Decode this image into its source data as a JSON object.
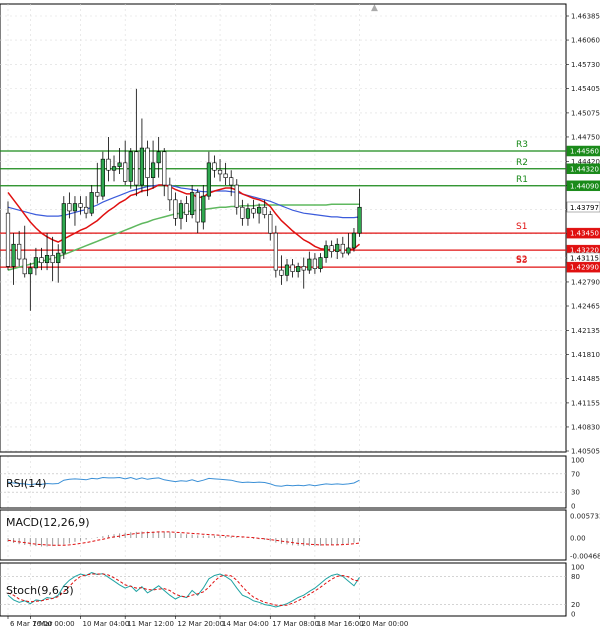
{
  "chart_data": {
    "type": "candlestick",
    "main": {
      "price_axis_ticks": [
        "1.46385",
        "1.46060",
        "1.45730",
        "1.45405",
        "1.45075",
        "1.44750",
        "1.44420",
        "1.44095",
        "1.43770",
        "1.43440",
        "1.43115",
        "1.42790",
        "1.42465",
        "1.42135",
        "1.41810",
        "1.41485",
        "1.41155",
        "1.40830",
        "1.40505"
      ],
      "ylim": [
        1.40505,
        1.46385
      ],
      "time_axis_ticks": [
        "6 Mar 16:00",
        "7 Mar 00:00",
        "10 Mar 04:00",
        "11 Mar 12:00",
        "12 Mar 20:00",
        "14 Mar 04:00",
        "17 Mar 08:00",
        "18 Mar 16:00",
        "20 Mar 00:00"
      ],
      "current_price": "1.43797",
      "levels": [
        {
          "label": "R3",
          "value": "1.44560",
          "color": "#1a8a1a"
        },
        {
          "label": "R2",
          "value": "1.44320",
          "color": "#1a8a1a"
        },
        {
          "label": "R1",
          "value": "1.44090",
          "color": "#1a8a1a"
        },
        {
          "label": "S1",
          "value": "1.43450",
          "color": "#e01010"
        },
        {
          "label": "",
          "value": "1.43220",
          "color": "#e01010"
        },
        {
          "label": "S2",
          "value": "",
          "color": "#e01010"
        },
        {
          "label": "",
          "value": "1.43115",
          "color": ""
        },
        {
          "label": "S3",
          "value": "1.42990",
          "color": "#e01010"
        }
      ],
      "candles": [
        [
          1.4372,
          1.4388,
          1.4295,
          1.43
        ],
        [
          1.43,
          1.4345,
          1.4275,
          1.433
        ],
        [
          1.433,
          1.4348,
          1.43,
          1.431
        ],
        [
          1.431,
          1.4355,
          1.4285,
          1.429
        ],
        [
          1.429,
          1.4305,
          1.424,
          1.4298
        ],
        [
          1.4298,
          1.4325,
          1.4288,
          1.4312
        ],
        [
          1.4312,
          1.4325,
          1.4295,
          1.4305
        ],
        [
          1.4305,
          1.4345,
          1.4295,
          1.4315
        ],
        [
          1.4315,
          1.434,
          1.428,
          1.4305
        ],
        [
          1.4305,
          1.433,
          1.4278,
          1.4318
        ],
        [
          1.4318,
          1.4395,
          1.431,
          1.4385
        ],
        [
          1.4385,
          1.44,
          1.4365,
          1.4375
        ],
        [
          1.4375,
          1.4395,
          1.4355,
          1.4385
        ],
        [
          1.4385,
          1.4395,
          1.437,
          1.438
        ],
        [
          1.438,
          1.4395,
          1.4365,
          1.4372
        ],
        [
          1.4372,
          1.441,
          1.4368,
          1.44
        ],
        [
          1.44,
          1.444,
          1.4385,
          1.4395
        ],
        [
          1.4395,
          1.4455,
          1.439,
          1.4445
        ],
        [
          1.4445,
          1.4475,
          1.4415,
          1.443
        ],
        [
          1.443,
          1.445,
          1.4415,
          1.4435
        ],
        [
          1.4435,
          1.446,
          1.4425,
          1.444
        ],
        [
          1.444,
          1.447,
          1.441,
          1.4415
        ],
        [
          1.4415,
          1.446,
          1.4405,
          1.4455
        ],
        [
          1.4455,
          1.454,
          1.4395,
          1.441
        ],
        [
          1.441,
          1.45,
          1.44,
          1.446
        ],
        [
          1.446,
          1.447,
          1.4395,
          1.442
        ],
        [
          1.442,
          1.447,
          1.4405,
          1.444
        ],
        [
          1.444,
          1.4475,
          1.442,
          1.4455
        ],
        [
          1.4455,
          1.446,
          1.4395,
          1.441
        ],
        [
          1.441,
          1.442,
          1.4375,
          1.439
        ],
        [
          1.439,
          1.44,
          1.4355,
          1.4365
        ],
        [
          1.4365,
          1.439,
          1.435,
          1.4385
        ],
        [
          1.4385,
          1.4395,
          1.436,
          1.437
        ],
        [
          1.437,
          1.441,
          1.4365,
          1.44
        ],
        [
          1.44,
          1.4405,
          1.4345,
          1.436
        ],
        [
          1.436,
          1.441,
          1.435,
          1.4395
        ],
        [
          1.4395,
          1.4455,
          1.439,
          1.444
        ],
        [
          1.444,
          1.445,
          1.442,
          1.443
        ],
        [
          1.443,
          1.4445,
          1.4415,
          1.4425
        ],
        [
          1.4425,
          1.444,
          1.441,
          1.442
        ],
        [
          1.442,
          1.443,
          1.4395,
          1.441
        ],
        [
          1.441,
          1.4418,
          1.437,
          1.438
        ],
        [
          1.438,
          1.439,
          1.4355,
          1.4365
        ],
        [
          1.4365,
          1.4385,
          1.4355,
          1.4378
        ],
        [
          1.4378,
          1.439,
          1.4365,
          1.4372
        ],
        [
          1.4372,
          1.4385,
          1.4358,
          1.438
        ],
        [
          1.438,
          1.439,
          1.4365,
          1.437
        ],
        [
          1.437,
          1.4375,
          1.4335,
          1.4345
        ],
        [
          1.4345,
          1.4355,
          1.4285,
          1.4295
        ],
        [
          1.4295,
          1.4315,
          1.4275,
          1.4288
        ],
        [
          1.4288,
          1.431,
          1.428,
          1.4302
        ],
        [
          1.4302,
          1.431,
          1.4285,
          1.4293
        ],
        [
          1.4293,
          1.4305,
          1.4285,
          1.43
        ],
        [
          1.43,
          1.4312,
          1.427,
          1.4295
        ],
        [
          1.4295,
          1.432,
          1.429,
          1.431
        ],
        [
          1.431,
          1.4318,
          1.429,
          1.4297
        ],
        [
          1.4297,
          1.4318,
          1.4292,
          1.4312
        ],
        [
          1.4312,
          1.4335,
          1.4305,
          1.4328
        ],
        [
          1.4328,
          1.4335,
          1.4312,
          1.432
        ],
        [
          1.432,
          1.4338,
          1.431,
          1.433
        ],
        [
          1.433,
          1.434,
          1.4312,
          1.4318
        ],
        [
          1.4318,
          1.4345,
          1.4315,
          1.4325
        ],
        [
          1.4325,
          1.4352,
          1.432,
          1.4345
        ],
        [
          1.4345,
          1.4405,
          1.434,
          1.438
        ]
      ],
      "ema_fast_red": [
        1.44,
        1.439,
        1.438,
        1.437,
        1.436,
        1.4352,
        1.4345,
        1.434,
        1.4336,
        1.4333,
        1.4337,
        1.4341,
        1.4345,
        1.4349,
        1.4352,
        1.4357,
        1.4362,
        1.4369,
        1.4375,
        1.438,
        1.4386,
        1.439,
        1.4396,
        1.4398,
        1.4402,
        1.4403,
        1.4406,
        1.441,
        1.441,
        1.4408,
        1.4404,
        1.4401,
        1.4398,
        1.4398,
        1.4393,
        1.4394,
        1.4399,
        1.4402,
        1.4404,
        1.4406,
        1.4406,
        1.4403,
        1.4398,
        1.4395,
        1.4392,
        1.439,
        1.4387,
        1.4381,
        1.4371,
        1.4362,
        1.4355,
        1.4348,
        1.4342,
        1.4336,
        1.4332,
        1.4327,
        1.4324,
        1.4323,
        1.4322,
        1.4322,
        1.4322,
        1.4322,
        1.4324,
        1.433
      ],
      "ma_mid_blue": [
        1.438,
        1.4378,
        1.4376,
        1.4374,
        1.4372,
        1.437,
        1.4369,
        1.4368,
        1.4368,
        1.4368,
        1.4369,
        1.4371,
        1.4373,
        1.4375,
        1.4377,
        1.438,
        1.4383,
        1.4387,
        1.439,
        1.4393,
        1.4396,
        1.4399,
        1.4402,
        1.4404,
        1.4406,
        1.4408,
        1.4409,
        1.441,
        1.441,
        1.4409,
        1.4408,
        1.4406,
        1.4405,
        1.4404,
        1.4402,
        1.4401,
        1.4401,
        1.4402,
        1.4402,
        1.4402,
        1.4401,
        1.44,
        1.4398,
        1.4396,
        1.4394,
        1.4392,
        1.439,
        1.4388,
        1.4385,
        1.4382,
        1.4379,
        1.4376,
        1.4374,
        1.4372,
        1.4371,
        1.437,
        1.4369,
        1.4368,
        1.4367,
        1.4367,
        1.4366,
        1.4366,
        1.4366,
        1.4367
      ],
      "ma_slow_green": [
        1.4295,
        1.4297,
        1.4299,
        1.4301,
        1.4303,
        1.4305,
        1.4307,
        1.4309,
        1.4311,
        1.4313,
        1.4316,
        1.4319,
        1.4322,
        1.4325,
        1.4328,
        1.4331,
        1.4334,
        1.4337,
        1.434,
        1.4343,
        1.4346,
        1.4349,
        1.4352,
        1.4355,
        1.4358,
        1.436,
        1.4363,
        1.4365,
        1.4367,
        1.4369,
        1.4371,
        1.4372,
        1.4374,
        1.4375,
        1.4376,
        1.4377,
        1.4378,
        1.4379,
        1.438,
        1.438,
        1.4381,
        1.4381,
        1.4382,
        1.4382,
        1.4382,
        1.4383,
        1.4383,
        1.4383,
        1.4383,
        1.4383,
        1.4383,
        1.4383,
        1.4383,
        1.4383,
        1.4383,
        1.4383,
        1.4383,
        1.4383,
        1.4384,
        1.4384,
        1.4384,
        1.4384,
        1.4384,
        1.4384
      ]
    },
    "rsi": {
      "title": "RSI(14)",
      "axis_ticks": [
        "100",
        "70",
        "30",
        "0"
      ],
      "levels": [
        70,
        30
      ],
      "values": [
        52,
        50,
        49,
        48,
        46,
        48,
        47,
        49,
        48,
        49,
        56,
        58,
        59,
        58,
        57,
        60,
        59,
        62,
        61,
        61,
        62,
        59,
        62,
        58,
        61,
        58,
        60,
        61,
        57,
        55,
        53,
        55,
        54,
        57,
        53,
        56,
        60,
        59,
        58,
        57,
        56,
        53,
        51,
        52,
        51,
        52,
        51,
        48,
        44,
        43,
        45,
        44,
        45,
        44,
        46,
        44,
        46,
        48,
        47,
        48,
        47,
        48,
        50,
        56
      ]
    },
    "macd": {
      "title": "MACD(12,26,9)",
      "axis_ticks": [
        "0.005733",
        "0.00",
        "-0.00468"
      ],
      "hist": [
        -0.001,
        -0.0013,
        -0.0016,
        -0.0018,
        -0.002,
        -0.0021,
        -0.0022,
        -0.0022,
        -0.0021,
        -0.002,
        -0.0017,
        -0.0014,
        -0.001,
        -0.0007,
        -0.0004,
        -0.0001,
        0.0002,
        0.0005,
        0.0008,
        0.001,
        0.0012,
        0.0014,
        0.0015,
        0.0016,
        0.0017,
        0.0017,
        0.0017,
        0.0017,
        0.0016,
        0.0015,
        0.0013,
        0.0012,
        0.001,
        0.0009,
        0.0007,
        0.0006,
        0.0006,
        0.0006,
        0.0006,
        0.0005,
        0.0004,
        0.0003,
        0.0001,
        0.0,
        -0.0002,
        -0.0003,
        -0.0005,
        -0.0008,
        -0.0012,
        -0.0015,
        -0.0017,
        -0.0019,
        -0.002,
        -0.0021,
        -0.0021,
        -0.0021,
        -0.002,
        -0.0019,
        -0.0018,
        -0.0017,
        -0.0016,
        -0.0014,
        -0.0012,
        -0.0008
      ],
      "signal": [
        -0.0006,
        -0.0008,
        -0.001,
        -0.0012,
        -0.0014,
        -0.0016,
        -0.0017,
        -0.0018,
        -0.0019,
        -0.0019,
        -0.0019,
        -0.0018,
        -0.0016,
        -0.0014,
        -0.0012,
        -0.0009,
        -0.0006,
        -0.0003,
        0.0,
        0.0003,
        0.0005,
        0.0008,
        0.001,
        0.0012,
        0.0013,
        0.0014,
        0.0015,
        0.0016,
        0.0016,
        0.0016,
        0.0015,
        0.0014,
        0.0013,
        0.0012,
        0.0011,
        0.001,
        0.0009,
        0.0008,
        0.0007,
        0.0006,
        0.0005,
        0.0004,
        0.0003,
        0.0002,
        0.0001,
        -0.0001,
        -0.0002,
        -0.0004,
        -0.0006,
        -0.0008,
        -0.001,
        -0.0012,
        -0.0014,
        -0.0015,
        -0.0016,
        -0.0017,
        -0.0018,
        -0.0018,
        -0.0018,
        -0.0018,
        -0.0017,
        -0.0016,
        -0.0015,
        -0.0013
      ]
    },
    "stoch": {
      "title": "Stoch(9,6,3)",
      "axis_ticks": [
        "100",
        "80",
        "20",
        "0"
      ],
      "levels": [
        80,
        20
      ],
      "k": [
        40,
        30,
        25,
        28,
        22,
        30,
        28,
        35,
        33,
        40,
        60,
        72,
        80,
        85,
        82,
        88,
        84,
        86,
        78,
        70,
        62,
        55,
        60,
        48,
        58,
        45,
        52,
        60,
        50,
        40,
        32,
        38,
        35,
        50,
        40,
        55,
        75,
        82,
        85,
        80,
        72,
        55,
        40,
        35,
        28,
        25,
        20,
        18,
        15,
        18,
        22,
        28,
        35,
        40,
        48,
        55,
        65,
        75,
        82,
        85,
        80,
        70,
        60,
        78
      ],
      "d": [
        45,
        40,
        32,
        28,
        26,
        27,
        28,
        31,
        33,
        37,
        47,
        59,
        71,
        80,
        83,
        85,
        85,
        85,
        83,
        77,
        70,
        62,
        59,
        55,
        56,
        52,
        51,
        53,
        54,
        50,
        42,
        38,
        36,
        40,
        43,
        47,
        57,
        70,
        80,
        83,
        81,
        72,
        58,
        46,
        36,
        30,
        25,
        22,
        19,
        18,
        19,
        23,
        28,
        35,
        42,
        49,
        57,
        66,
        74,
        80,
        82,
        79,
        72,
        70
      ]
    }
  }
}
